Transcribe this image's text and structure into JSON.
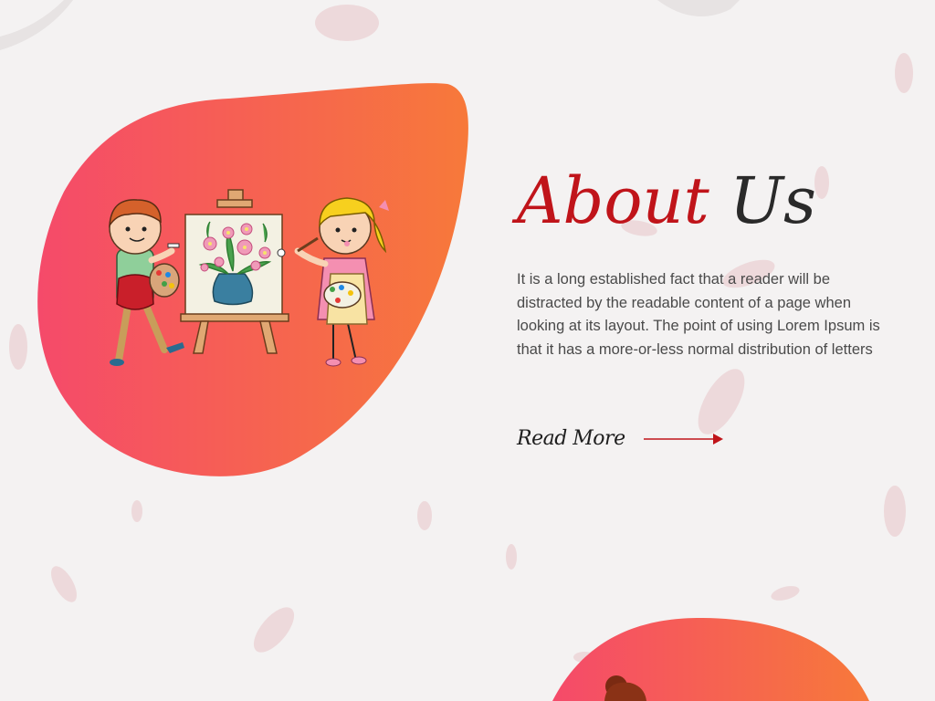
{
  "about": {
    "heading_part1": "About",
    "heading_part2": "Us",
    "body": "It is a long established fact that a reader will be distracted by the readable content of a page when looking at its layout. The point of using Lorem Ipsum is that it has a more-or-less normal distribution of letters",
    "read_more_label": "Read More"
  },
  "colors": {
    "blob_gradient_start": "#f54a6a",
    "blob_gradient_end": "#f7793a",
    "heading_accent": "#c0141a",
    "heading_dark": "#2a2a2a",
    "arrow": "#c0141a",
    "background": "#f4f2f2"
  },
  "icons": {
    "illustration": "children-painting-easel-illustration",
    "arrow": "arrow-right-icon"
  }
}
